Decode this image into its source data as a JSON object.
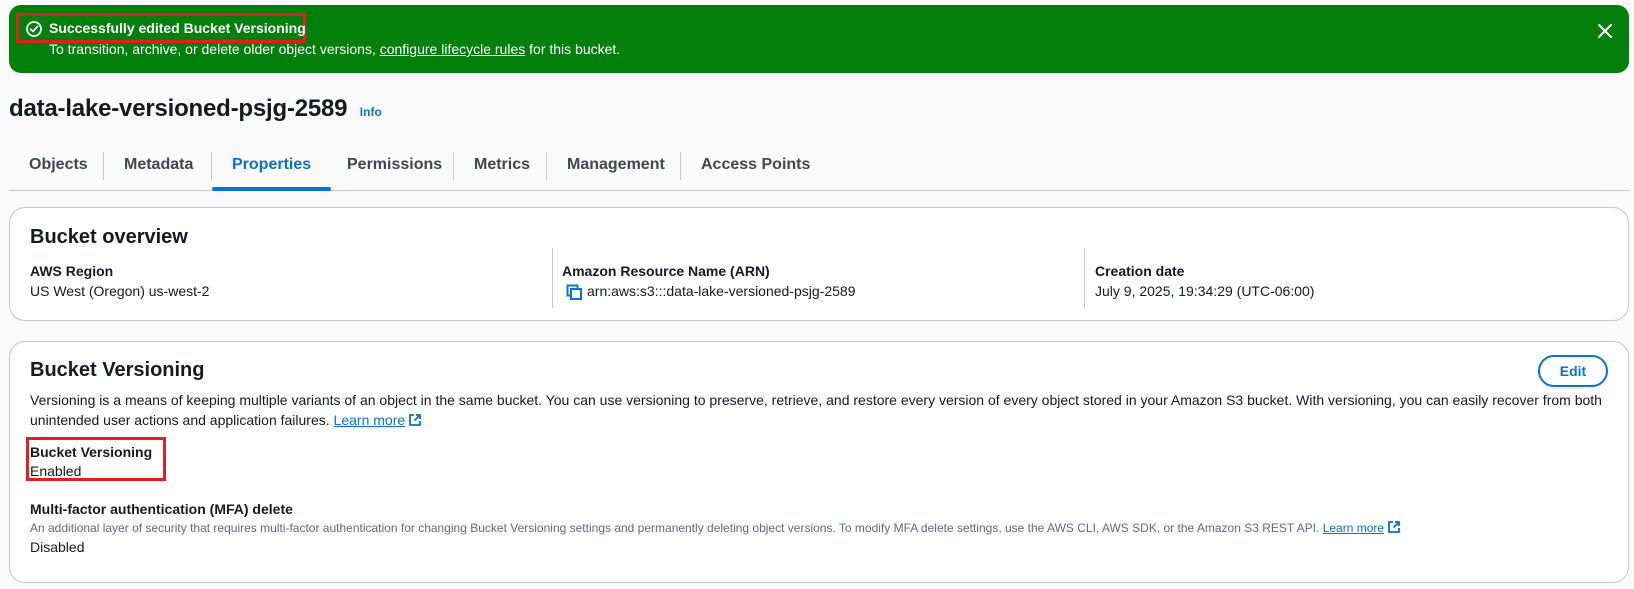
{
  "flash": {
    "title": "Successfully edited Bucket Versioning",
    "message_prefix": "To transition, archive, or delete older object versions,",
    "link_text": "configure lifecycle rules",
    "message_suffix": "for this bucket.",
    "status_icon": "success-check-circle-icon",
    "close_icon": "close-icon",
    "color": "#037f0c"
  },
  "header": {
    "title": "data-lake-versioned-psjg-2589",
    "info_label": "Info"
  },
  "tabs": [
    {
      "label": "Objects",
      "active": false
    },
    {
      "label": "Metadata",
      "active": false
    },
    {
      "label": "Properties",
      "active": true
    },
    {
      "label": "Permissions",
      "active": false
    },
    {
      "label": "Metrics",
      "active": false
    },
    {
      "label": "Management",
      "active": false
    },
    {
      "label": "Access Points",
      "active": false
    }
  ],
  "overview": {
    "title": "Bucket overview",
    "region": {
      "label": "AWS Region",
      "value": "US West (Oregon) us-west-2"
    },
    "arn": {
      "label": "Amazon Resource Name (ARN)",
      "value": "arn:aws:s3:::data-lake-versioned-psjg-2589",
      "icon": "copy-icon"
    },
    "creation": {
      "label": "Creation date",
      "value": "July 9, 2025, 19:34:29 (UTC-06:00)"
    }
  },
  "versioning": {
    "title": "Bucket Versioning",
    "edit_label": "Edit",
    "description": "Versioning is a means of keeping multiple variants of an object in the same bucket. You can use versioning to preserve, retrieve, and restore every version of every object stored in your Amazon S3 bucket. With versioning, you can easily recover from both unintended user actions and application failures.",
    "learn_more": "Learn more",
    "status_label": "Bucket Versioning",
    "status_value": "Enabled",
    "mfa": {
      "label": "Multi-factor authentication (MFA) delete",
      "description": "An additional layer of security that requires multi-factor authentication for changing Bucket Versioning settings and permanently deleting object versions. To modify MFA delete settings, use the AWS CLI, AWS SDK, or the Amazon S3 REST API.",
      "learn_more": "Learn more",
      "value": "Disabled"
    }
  },
  "colors": {
    "accent": "#0972d3",
    "highlight": "#e02020"
  }
}
